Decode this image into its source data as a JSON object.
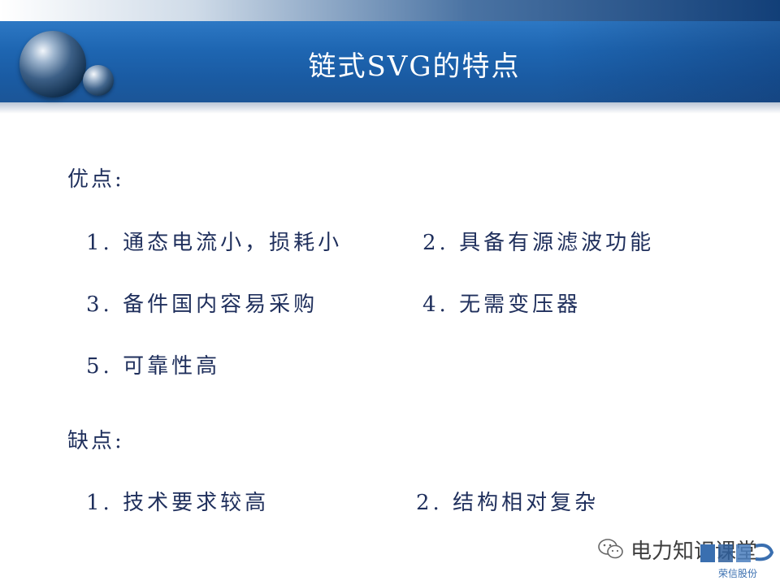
{
  "slide": {
    "title": "链式SVG的特点"
  },
  "advantages": {
    "heading": "优点:",
    "items": [
      "1. 通态电流小，损耗小",
      "2. 具备有源滤波功能",
      "3. 备件国内容易采购",
      "4. 无需变压器",
      "5. 可靠性高"
    ]
  },
  "disadvantages": {
    "heading": "缺点:",
    "items": [
      "1. 技术要求较高",
      "2. 结构相对复杂"
    ]
  },
  "watermark": {
    "icon": "wechat-icon",
    "text": "电力知识课堂"
  },
  "logo": {
    "text": "荣信股份",
    "accent_color": "#3a6fb0"
  },
  "colors": {
    "title_bar": "#1e66b2",
    "body_text": "#1f2f5c"
  }
}
